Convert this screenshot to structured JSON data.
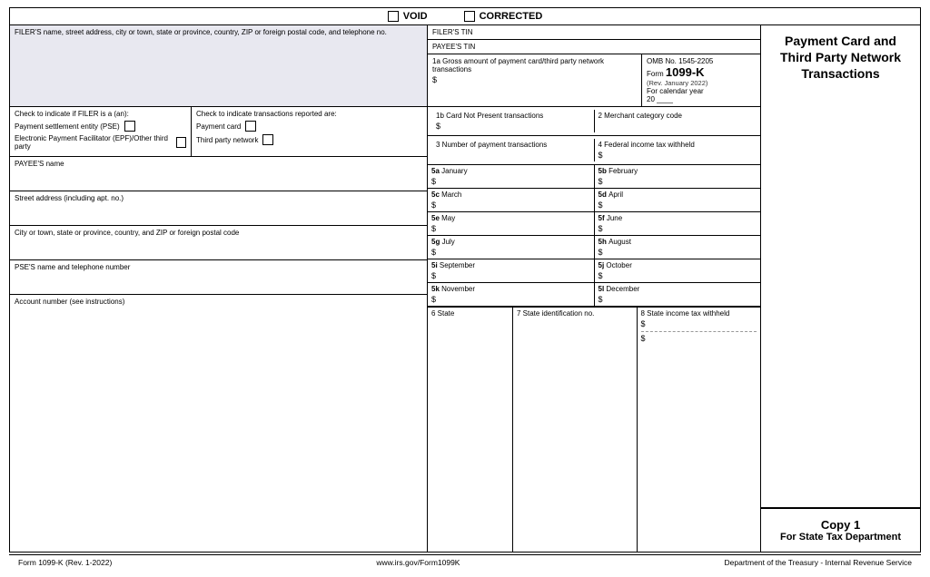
{
  "header": {
    "void_label": "VOID",
    "corrected_label": "CORRECTED"
  },
  "left": {
    "filer_info_label": "FILER'S name, street address, city or town, state or province, country, ZIP or foreign postal code, and telephone no.",
    "check_filer_label": "Check to indicate if FILER is a (an):",
    "pse_label": "Payment settlement entity (PSE)",
    "epf_label": "Electronic Payment Facilitator (EPF)/Other third party",
    "check_transactions_label": "Check to indicate transactions reported are:",
    "payment_card_label": "Payment card",
    "third_party_label": "Third party network",
    "payee_name_label": "PAYEE'S name",
    "street_label": "Street address (including apt. no.)",
    "city_label": "City or town, state or province, country, and ZIP or foreign postal code",
    "pse_name_label": "PSE'S name and telephone number",
    "account_label": "Account number (see instructions)"
  },
  "right": {
    "filers_tin_label": "FILER'S TIN",
    "payees_tin_label": "PAYEE'S TIN",
    "gross_amount_label": "1a Gross amount of payment card/third party network transactions",
    "gross_dollar": "$",
    "omb_no": "OMB No. 1545-2205",
    "form_label": "Form",
    "form_number": "1099-K",
    "rev_label": "(Rev. January 2022)",
    "cal_year_label": "For calendar year",
    "cal_year_value": "20 ____",
    "card_not_present_label": "1b Card Not Present transactions",
    "card_dollar": "$",
    "merchant_label": "2  Merchant category code",
    "num_transactions_label": "3  Number of payment transactions",
    "fed_income_label": "4  Federal income tax withheld",
    "fed_dollar": "$",
    "fields_5": [
      {
        "key": "5a",
        "month": "January"
      },
      {
        "key": "5b",
        "month": "February"
      },
      {
        "key": "5c",
        "month": "March"
      },
      {
        "key": "5d",
        "month": "April"
      },
      {
        "key": "5e",
        "month": "May"
      },
      {
        "key": "5f",
        "month": "June"
      },
      {
        "key": "5g",
        "month": "July"
      },
      {
        "key": "5h",
        "month": "August"
      },
      {
        "key": "5i",
        "month": "September"
      },
      {
        "key": "5j",
        "month": "October"
      },
      {
        "key": "5k",
        "month": "November"
      },
      {
        "key": "5l",
        "month": "December"
      }
    ],
    "state_label": "6  State",
    "state_id_label": "7  State identification no.",
    "state_income_label": "8  State income tax withheld",
    "state_dollar": "$",
    "dollar": "$"
  },
  "side_panel": {
    "title": "Payment Card and Third Party Network Transactions",
    "copy_label": "Copy 1",
    "copy_sub": "For State Tax Department"
  },
  "footer": {
    "form_ref": "Form 1099-K (Rev. 1-2022)",
    "website": "www.irs.gov/Form1099K",
    "dept": "Department of the Treasury - Internal Revenue Service"
  }
}
